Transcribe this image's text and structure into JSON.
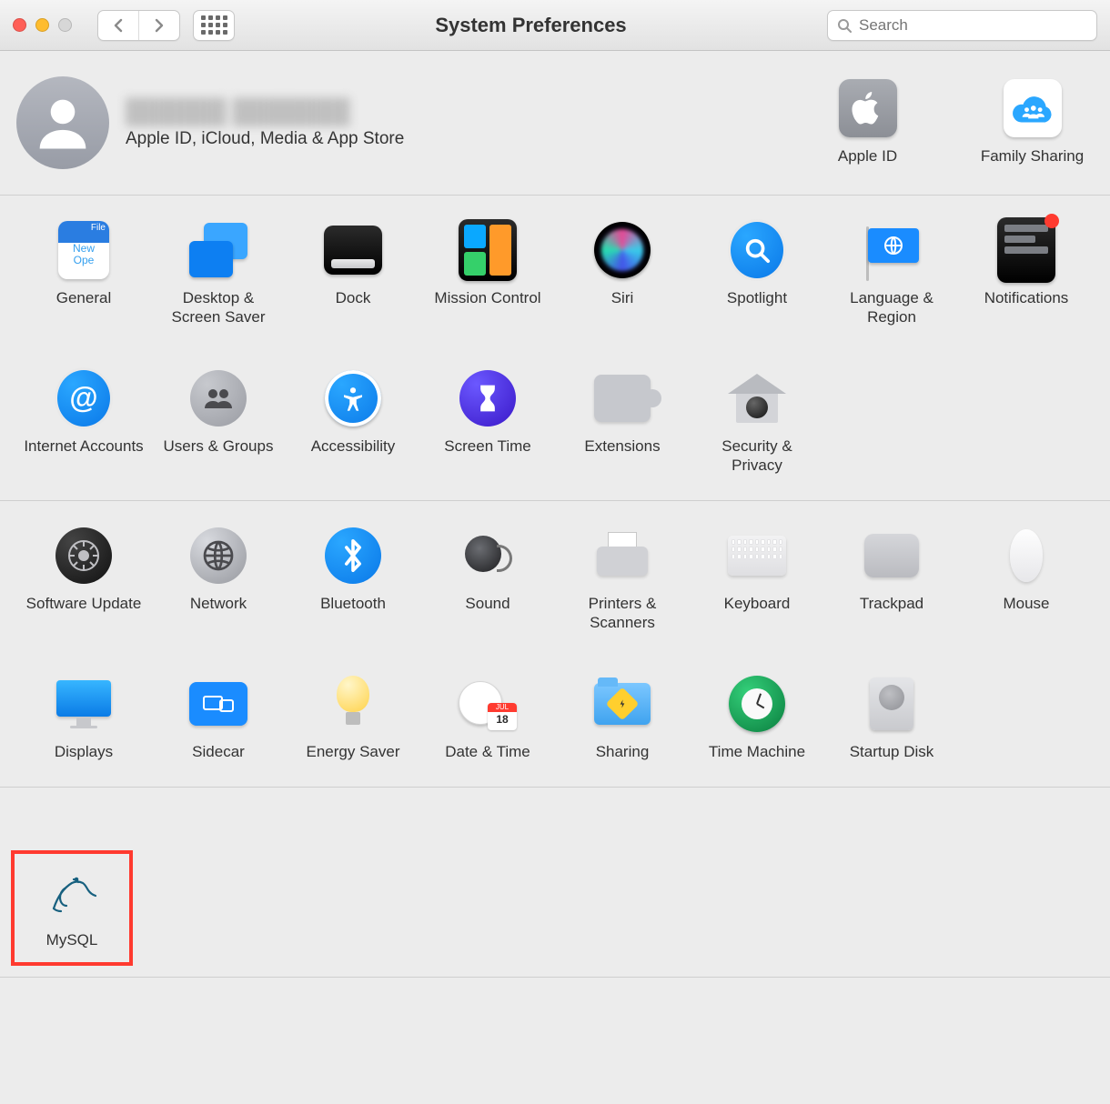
{
  "window": {
    "title": "System Preferences",
    "search_placeholder": "Search"
  },
  "account": {
    "display_name": "██████ ███████",
    "subtitle": "Apple ID, iCloud, Media & App Store",
    "quick": {
      "apple_id": "Apple ID",
      "family_sharing": "Family Sharing"
    }
  },
  "row1": {
    "general": "General",
    "desktop": "Desktop & Screen Saver",
    "dock": "Dock",
    "mission_control": "Mission Control",
    "siri": "Siri",
    "spotlight": "Spotlight",
    "language": "Language & Region",
    "notifications": "Notifications",
    "internet_accounts": "Internet Accounts",
    "users_groups": "Users & Groups",
    "accessibility": "Accessibility",
    "screen_time": "Screen Time",
    "extensions": "Extensions",
    "security": "Security & Privacy"
  },
  "row2": {
    "software_update": "Software Update",
    "network": "Network",
    "bluetooth": "Bluetooth",
    "sound": "Sound",
    "printers": "Printers & Scanners",
    "keyboard": "Keyboard",
    "trackpad": "Trackpad",
    "mouse": "Mouse",
    "displays": "Displays",
    "sidecar": "Sidecar",
    "energy_saver": "Energy Saver",
    "date_time": "Date & Time",
    "sharing": "Sharing",
    "time_machine": "Time Machine",
    "startup_disk": "Startup Disk"
  },
  "row3": {
    "mysql": "MySQL"
  },
  "calendar_badge": {
    "month": "JUL",
    "day": "18"
  },
  "general_tile": {
    "tag": "File",
    "l1": "New",
    "l2": "Ope"
  }
}
